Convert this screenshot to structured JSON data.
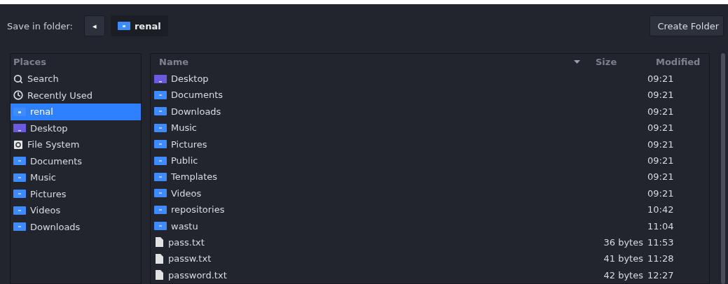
{
  "toolbar": {
    "label": "Save in folder:",
    "back": "◂",
    "path": {
      "name": "renal",
      "kind": "home"
    },
    "create_button": "Create Folder"
  },
  "places": {
    "title": "Places",
    "items": [
      {
        "label": "Search",
        "kind": "search",
        "selected": false
      },
      {
        "label": "Recently Used",
        "kind": "recent",
        "selected": false
      },
      {
        "label": "renal",
        "kind": "home",
        "selected": true
      },
      {
        "label": "Desktop",
        "kind": "desktop",
        "selected": false
      },
      {
        "label": "File System",
        "kind": "drive",
        "selected": false
      },
      {
        "label": "Documents",
        "kind": "folder",
        "selected": false
      },
      {
        "label": "Music",
        "kind": "folder",
        "selected": false
      },
      {
        "label": "Pictures",
        "kind": "folder",
        "selected": false
      },
      {
        "label": "Videos",
        "kind": "folder",
        "selected": false
      },
      {
        "label": "Downloads",
        "kind": "folder",
        "selected": false
      }
    ]
  },
  "files": {
    "columns": [
      "Name",
      "Size",
      "Modified"
    ],
    "rows": [
      {
        "name": "Desktop",
        "kind": "desktop",
        "size": "",
        "modified": "09:21"
      },
      {
        "name": "Documents",
        "kind": "folder",
        "size": "",
        "modified": "09:21"
      },
      {
        "name": "Downloads",
        "kind": "folder",
        "size": "",
        "modified": "09:21"
      },
      {
        "name": "Music",
        "kind": "folder",
        "size": "",
        "modified": "09:21"
      },
      {
        "name": "Pictures",
        "kind": "folder",
        "size": "",
        "modified": "09:21"
      },
      {
        "name": "Public",
        "kind": "folder",
        "size": "",
        "modified": "09:21"
      },
      {
        "name": "Templates",
        "kind": "folder",
        "size": "",
        "modified": "09:21"
      },
      {
        "name": "Videos",
        "kind": "folder",
        "size": "",
        "modified": "09:21"
      },
      {
        "name": "repositories",
        "kind": "folder",
        "size": "",
        "modified": "10:42"
      },
      {
        "name": "wastu",
        "kind": "folder",
        "size": "",
        "modified": "11:04"
      },
      {
        "name": "pass.txt",
        "kind": "file",
        "size": "36 bytes",
        "modified": "11:53"
      },
      {
        "name": "passw.txt",
        "kind": "file",
        "size": "41 bytes",
        "modified": "11:28"
      },
      {
        "name": "password.txt",
        "kind": "file",
        "size": "42 bytes",
        "modified": "12:27"
      }
    ]
  }
}
